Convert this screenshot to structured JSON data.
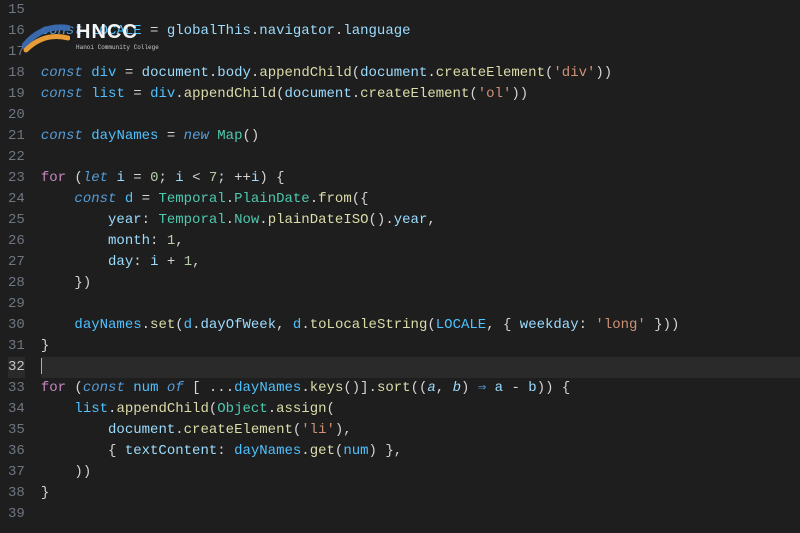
{
  "logo": {
    "text": "HNCC",
    "subtitle": "Hanoi Community College"
  },
  "current_line": 32,
  "lines": [
    {
      "n": 15,
      "tokens": []
    },
    {
      "n": 16,
      "tokens": [
        {
          "t": "kw-decl",
          "v": "const "
        },
        {
          "t": "var",
          "v": "LOCALE"
        },
        {
          "t": "op",
          "v": " = "
        },
        {
          "t": "ident",
          "v": "globalThis"
        },
        {
          "t": "punct",
          "v": "."
        },
        {
          "t": "prop",
          "v": "navigator"
        },
        {
          "t": "punct",
          "v": "."
        },
        {
          "t": "prop",
          "v": "language"
        }
      ]
    },
    {
      "n": 17,
      "tokens": []
    },
    {
      "n": 18,
      "tokens": [
        {
          "t": "kw-decl",
          "v": "const "
        },
        {
          "t": "var",
          "v": "div"
        },
        {
          "t": "op",
          "v": " = "
        },
        {
          "t": "ident",
          "v": "document"
        },
        {
          "t": "punct",
          "v": "."
        },
        {
          "t": "prop",
          "v": "body"
        },
        {
          "t": "punct",
          "v": "."
        },
        {
          "t": "func",
          "v": "appendChild"
        },
        {
          "t": "punct",
          "v": "("
        },
        {
          "t": "ident",
          "v": "document"
        },
        {
          "t": "punct",
          "v": "."
        },
        {
          "t": "func",
          "v": "createElement"
        },
        {
          "t": "punct",
          "v": "("
        },
        {
          "t": "str",
          "v": "'div'"
        },
        {
          "t": "punct",
          "v": "))"
        }
      ]
    },
    {
      "n": 19,
      "tokens": [
        {
          "t": "kw-decl",
          "v": "const "
        },
        {
          "t": "var",
          "v": "list"
        },
        {
          "t": "op",
          "v": " = "
        },
        {
          "t": "var",
          "v": "div"
        },
        {
          "t": "punct",
          "v": "."
        },
        {
          "t": "func",
          "v": "appendChild"
        },
        {
          "t": "punct",
          "v": "("
        },
        {
          "t": "ident",
          "v": "document"
        },
        {
          "t": "punct",
          "v": "."
        },
        {
          "t": "func",
          "v": "createElement"
        },
        {
          "t": "punct",
          "v": "("
        },
        {
          "t": "str",
          "v": "'ol'"
        },
        {
          "t": "punct",
          "v": "))"
        }
      ]
    },
    {
      "n": 20,
      "tokens": []
    },
    {
      "n": 21,
      "tokens": [
        {
          "t": "kw-decl",
          "v": "const "
        },
        {
          "t": "var",
          "v": "dayNames"
        },
        {
          "t": "op",
          "v": " = "
        },
        {
          "t": "kw-decl",
          "v": "new "
        },
        {
          "t": "class",
          "v": "Map"
        },
        {
          "t": "punct",
          "v": "()"
        }
      ]
    },
    {
      "n": 22,
      "tokens": []
    },
    {
      "n": 23,
      "tokens": [
        {
          "t": "kw-ctrl",
          "v": "for"
        },
        {
          "t": "punct",
          "v": " ("
        },
        {
          "t": "kw-decl",
          "v": "let "
        },
        {
          "t": "ident",
          "v": "i"
        },
        {
          "t": "op",
          "v": " = "
        },
        {
          "t": "num",
          "v": "0"
        },
        {
          "t": "punct",
          "v": "; "
        },
        {
          "t": "ident",
          "v": "i"
        },
        {
          "t": "op",
          "v": " < "
        },
        {
          "t": "num",
          "v": "7"
        },
        {
          "t": "punct",
          "v": "; "
        },
        {
          "t": "op",
          "v": "++"
        },
        {
          "t": "ident",
          "v": "i"
        },
        {
          "t": "punct",
          "v": ") {"
        }
      ]
    },
    {
      "n": 24,
      "tokens": [
        {
          "t": "punct",
          "v": "    "
        },
        {
          "t": "kw-decl",
          "v": "const "
        },
        {
          "t": "var",
          "v": "d"
        },
        {
          "t": "op",
          "v": " = "
        },
        {
          "t": "class",
          "v": "Temporal"
        },
        {
          "t": "punct",
          "v": "."
        },
        {
          "t": "class",
          "v": "PlainDate"
        },
        {
          "t": "punct",
          "v": "."
        },
        {
          "t": "func",
          "v": "from"
        },
        {
          "t": "punct",
          "v": "({"
        }
      ]
    },
    {
      "n": 25,
      "tokens": [
        {
          "t": "punct",
          "v": "        "
        },
        {
          "t": "prop",
          "v": "year"
        },
        {
          "t": "punct",
          "v": ": "
        },
        {
          "t": "class",
          "v": "Temporal"
        },
        {
          "t": "punct",
          "v": "."
        },
        {
          "t": "class",
          "v": "Now"
        },
        {
          "t": "punct",
          "v": "."
        },
        {
          "t": "func",
          "v": "plainDateISO"
        },
        {
          "t": "punct",
          "v": "()."
        },
        {
          "t": "prop",
          "v": "year"
        },
        {
          "t": "punct",
          "v": ","
        }
      ]
    },
    {
      "n": 26,
      "tokens": [
        {
          "t": "punct",
          "v": "        "
        },
        {
          "t": "prop",
          "v": "month"
        },
        {
          "t": "punct",
          "v": ": "
        },
        {
          "t": "num",
          "v": "1"
        },
        {
          "t": "punct",
          "v": ","
        }
      ]
    },
    {
      "n": 27,
      "tokens": [
        {
          "t": "punct",
          "v": "        "
        },
        {
          "t": "prop",
          "v": "day"
        },
        {
          "t": "punct",
          "v": ": "
        },
        {
          "t": "ident",
          "v": "i"
        },
        {
          "t": "op",
          "v": " + "
        },
        {
          "t": "num",
          "v": "1"
        },
        {
          "t": "punct",
          "v": ","
        }
      ]
    },
    {
      "n": 28,
      "tokens": [
        {
          "t": "punct",
          "v": "    })"
        }
      ]
    },
    {
      "n": 29,
      "tokens": []
    },
    {
      "n": 30,
      "tokens": [
        {
          "t": "punct",
          "v": "    "
        },
        {
          "t": "var",
          "v": "dayNames"
        },
        {
          "t": "punct",
          "v": "."
        },
        {
          "t": "func",
          "v": "set"
        },
        {
          "t": "punct",
          "v": "("
        },
        {
          "t": "var",
          "v": "d"
        },
        {
          "t": "punct",
          "v": "."
        },
        {
          "t": "prop",
          "v": "dayOfWeek"
        },
        {
          "t": "punct",
          "v": ", "
        },
        {
          "t": "var",
          "v": "d"
        },
        {
          "t": "punct",
          "v": "."
        },
        {
          "t": "func",
          "v": "toLocaleString"
        },
        {
          "t": "punct",
          "v": "("
        },
        {
          "t": "var",
          "v": "LOCALE"
        },
        {
          "t": "punct",
          "v": ", { "
        },
        {
          "t": "prop",
          "v": "weekday"
        },
        {
          "t": "punct",
          "v": ": "
        },
        {
          "t": "str",
          "v": "'long'"
        },
        {
          "t": "punct",
          "v": " }))"
        }
      ]
    },
    {
      "n": 31,
      "tokens": [
        {
          "t": "punct",
          "v": "}"
        }
      ]
    },
    {
      "n": 32,
      "tokens": []
    },
    {
      "n": 33,
      "tokens": [
        {
          "t": "kw-ctrl",
          "v": "for"
        },
        {
          "t": "punct",
          "v": " ("
        },
        {
          "t": "kw-decl",
          "v": "const "
        },
        {
          "t": "var",
          "v": "num"
        },
        {
          "t": "kw-decl",
          "v": " of "
        },
        {
          "t": "punct",
          "v": "[ ..."
        },
        {
          "t": "var",
          "v": "dayNames"
        },
        {
          "t": "punct",
          "v": "."
        },
        {
          "t": "func",
          "v": "keys"
        },
        {
          "t": "punct",
          "v": "()]."
        },
        {
          "t": "func",
          "v": "sort"
        },
        {
          "t": "punct",
          "v": "(("
        },
        {
          "t": "param",
          "v": "a"
        },
        {
          "t": "punct",
          "v": ", "
        },
        {
          "t": "param",
          "v": "b"
        },
        {
          "t": "punct",
          "v": ") "
        },
        {
          "t": "kw-decl",
          "v": "⇒"
        },
        {
          "t": "punct",
          "v": " "
        },
        {
          "t": "ident",
          "v": "a"
        },
        {
          "t": "op",
          "v": " - "
        },
        {
          "t": "ident",
          "v": "b"
        },
        {
          "t": "punct",
          "v": ")) {"
        }
      ]
    },
    {
      "n": 34,
      "tokens": [
        {
          "t": "punct",
          "v": "    "
        },
        {
          "t": "var",
          "v": "list"
        },
        {
          "t": "punct",
          "v": "."
        },
        {
          "t": "func",
          "v": "appendChild"
        },
        {
          "t": "punct",
          "v": "("
        },
        {
          "t": "class",
          "v": "Object"
        },
        {
          "t": "punct",
          "v": "."
        },
        {
          "t": "func",
          "v": "assign"
        },
        {
          "t": "punct",
          "v": "("
        }
      ]
    },
    {
      "n": 35,
      "tokens": [
        {
          "t": "punct",
          "v": "        "
        },
        {
          "t": "ident",
          "v": "document"
        },
        {
          "t": "punct",
          "v": "."
        },
        {
          "t": "func",
          "v": "createElement"
        },
        {
          "t": "punct",
          "v": "("
        },
        {
          "t": "str",
          "v": "'li'"
        },
        {
          "t": "punct",
          "v": "),"
        }
      ]
    },
    {
      "n": 36,
      "tokens": [
        {
          "t": "punct",
          "v": "        { "
        },
        {
          "t": "prop",
          "v": "textContent"
        },
        {
          "t": "punct",
          "v": ": "
        },
        {
          "t": "var",
          "v": "dayNames"
        },
        {
          "t": "punct",
          "v": "."
        },
        {
          "t": "func",
          "v": "get"
        },
        {
          "t": "punct",
          "v": "("
        },
        {
          "t": "var",
          "v": "num"
        },
        {
          "t": "punct",
          "v": ") },"
        }
      ]
    },
    {
      "n": 37,
      "tokens": [
        {
          "t": "punct",
          "v": "    ))"
        }
      ]
    },
    {
      "n": 38,
      "tokens": [
        {
          "t": "punct",
          "v": "}"
        }
      ]
    },
    {
      "n": 39,
      "tokens": []
    }
  ]
}
